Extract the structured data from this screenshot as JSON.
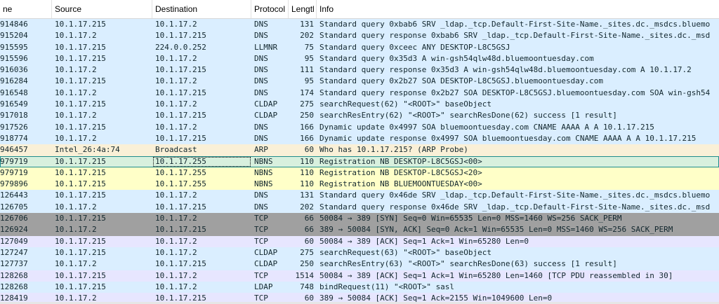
{
  "columns": [
    "ne",
    "Source",
    "Destination",
    "Protocol",
    "Lengtl",
    "Info"
  ],
  "colors": {
    "DNS": "#daeeff",
    "LLMNR": "#daeeff",
    "CLDAP": "#daeeff",
    "LDAP": "#daeeff",
    "ARP": "#faf0d7",
    "NBNS": "#ffffc8",
    "NBNS_SEL": "#d8f0de",
    "TCP_SYN": "#a0a0a0",
    "TCP": "#e7e6ff"
  },
  "rows": [
    {
      "no": "914846",
      "src": "10.1.17.215",
      "dst": "10.1.17.2",
      "proto": "DNS",
      "len": "131",
      "info": "Standard query 0xbab6 SRV _ldap._tcp.Default-First-Site-Name._sites.dc._msdcs.bluemo",
      "bg": "DNS"
    },
    {
      "no": "915204",
      "src": "10.1.17.2",
      "dst": "10.1.17.215",
      "proto": "DNS",
      "len": "202",
      "info": "Standard query response 0xbab6 SRV _ldap._tcp.Default-First-Site-Name._sites.dc._msd",
      "bg": "DNS"
    },
    {
      "no": "915595",
      "src": "10.1.17.215",
      "dst": "224.0.0.252",
      "proto": "LLMNR",
      "len": "75",
      "info": "Standard query 0xceec ANY DESKTOP-L8C5GSJ",
      "bg": "LLMNR"
    },
    {
      "no": "915596",
      "src": "10.1.17.215",
      "dst": "10.1.17.2",
      "proto": "DNS",
      "len": "95",
      "info": "Standard query 0x35d3 A win-gsh54qlw48d.bluemoontuesday.com",
      "bg": "DNS"
    },
    {
      "no": "916036",
      "src": "10.1.17.2",
      "dst": "10.1.17.215",
      "proto": "DNS",
      "len": "111",
      "info": "Standard query response 0x35d3 A win-gsh54qlw48d.bluemoontuesday.com A 10.1.17.2",
      "bg": "DNS"
    },
    {
      "no": "916284",
      "src": "10.1.17.215",
      "dst": "10.1.17.2",
      "proto": "DNS",
      "len": "95",
      "info": "Standard query 0x2b27 SOA DESKTOP-L8C5GSJ.bluemoontuesday.com",
      "bg": "DNS"
    },
    {
      "no": "916548",
      "src": "10.1.17.2",
      "dst": "10.1.17.215",
      "proto": "DNS",
      "len": "174",
      "info": "Standard query response 0x2b27 SOA DESKTOP-L8C5GSJ.bluemoontuesday.com SOA win-gsh54",
      "bg": "DNS"
    },
    {
      "no": "916549",
      "src": "10.1.17.215",
      "dst": "10.1.17.2",
      "proto": "CLDAP",
      "len": "275",
      "info": "searchRequest(62) \"<ROOT>\" baseObject",
      "bg": "CLDAP"
    },
    {
      "no": "917018",
      "src": "10.1.17.2",
      "dst": "10.1.17.215",
      "proto": "CLDAP",
      "len": "250",
      "info": "searchResEntry(62) \"<ROOT>\" searchResDone(62) success  [1 result]",
      "bg": "CLDAP"
    },
    {
      "no": "917526",
      "src": "10.1.17.215",
      "dst": "10.1.17.2",
      "proto": "DNS",
      "len": "166",
      "info": "Dynamic update 0x4997 SOA bluemoontuesday.com CNAME AAAA A A 10.1.17.215",
      "bg": "DNS"
    },
    {
      "no": "918774",
      "src": "10.1.17.2",
      "dst": "10.1.17.215",
      "proto": "DNS",
      "len": "166",
      "info": "Dynamic update response 0x4997 SOA bluemoontuesday.com CNAME AAAA A A 10.1.17.215",
      "bg": "DNS"
    },
    {
      "no": "946457",
      "src": "Intel_26:4a:74",
      "dst": "Broadcast",
      "proto": "ARP",
      "len": "60",
      "info": "Who has 10.1.17.215? (ARP Probe)",
      "bg": "ARP"
    },
    {
      "no": "979719",
      "src": "10.1.17.215",
      "dst": "10.1.17.255",
      "proto": "NBNS",
      "len": "110",
      "info": "Registration NB DESKTOP-L8C5GSJ<00>",
      "bg": "NBNS_SEL",
      "selected": true
    },
    {
      "no": "979719",
      "src": "10.1.17.215",
      "dst": "10.1.17.255",
      "proto": "NBNS",
      "len": "110",
      "info": "Registration NB DESKTOP-L8C5GSJ<20>",
      "bg": "NBNS"
    },
    {
      "no": "979896",
      "src": "10.1.17.215",
      "dst": "10.1.17.255",
      "proto": "NBNS",
      "len": "110",
      "info": "Registration NB BLUEMOONTUESDAY<00>",
      "bg": "NBNS"
    },
    {
      "no": "126443",
      "src": "10.1.17.215",
      "dst": "10.1.17.2",
      "proto": "DNS",
      "len": "131",
      "info": "Standard query 0x46de SRV _ldap._tcp.Default-First-Site-Name._sites.dc._msdcs.bluemo",
      "bg": "DNS"
    },
    {
      "no": "126705",
      "src": "10.1.17.2",
      "dst": "10.1.17.215",
      "proto": "DNS",
      "len": "202",
      "info": "Standard query response 0x46de SRV _ldap._tcp.Default-First-Site-Name._sites.dc._msd",
      "bg": "DNS"
    },
    {
      "no": "126706",
      "src": "10.1.17.215",
      "dst": "10.1.17.2",
      "proto": "TCP",
      "len": "66",
      "info": "50084 → 389 [SYN] Seq=0 Win=65535 Len=0 MSS=1460 WS=256 SACK_PERM",
      "bg": "TCP_SYN"
    },
    {
      "no": "126924",
      "src": "10.1.17.2",
      "dst": "10.1.17.215",
      "proto": "TCP",
      "len": "66",
      "info": "389 → 50084 [SYN, ACK] Seq=0 Ack=1 Win=65535 Len=0 MSS=1460 WS=256 SACK_PERM",
      "bg": "TCP_SYN"
    },
    {
      "no": "127049",
      "src": "10.1.17.215",
      "dst": "10.1.17.2",
      "proto": "TCP",
      "len": "60",
      "info": "50084 → 389 [ACK] Seq=1 Ack=1 Win=65280 Len=0",
      "bg": "TCP"
    },
    {
      "no": "127247",
      "src": "10.1.17.215",
      "dst": "10.1.17.2",
      "proto": "CLDAP",
      "len": "275",
      "info": "searchRequest(63) \"<ROOT>\" baseObject",
      "bg": "CLDAP"
    },
    {
      "no": "127737",
      "src": "10.1.17.2",
      "dst": "10.1.17.215",
      "proto": "CLDAP",
      "len": "250",
      "info": "searchResEntry(63) \"<ROOT>\" searchResDone(63) success  [1 result]",
      "bg": "CLDAP"
    },
    {
      "no": "128268",
      "src": "10.1.17.215",
      "dst": "10.1.17.2",
      "proto": "TCP",
      "len": "1514",
      "info": "50084 → 389 [ACK] Seq=1 Ack=1 Win=65280 Len=1460 [TCP PDU reassembled in 30]",
      "bg": "TCP"
    },
    {
      "no": "128268",
      "src": "10.1.17.215",
      "dst": "10.1.17.2",
      "proto": "LDAP",
      "len": "748",
      "info": "bindRequest(11) \"<ROOT>\" sasl",
      "bg": "LDAP"
    },
    {
      "no": "128419",
      "src": "10.1.17.2",
      "dst": "10.1.17.215",
      "proto": "TCP",
      "len": "60",
      "info": "389 → 50084 [ACK] Seq=1 Ack=2155 Win=1049600 Len=0",
      "bg": "TCP"
    }
  ]
}
